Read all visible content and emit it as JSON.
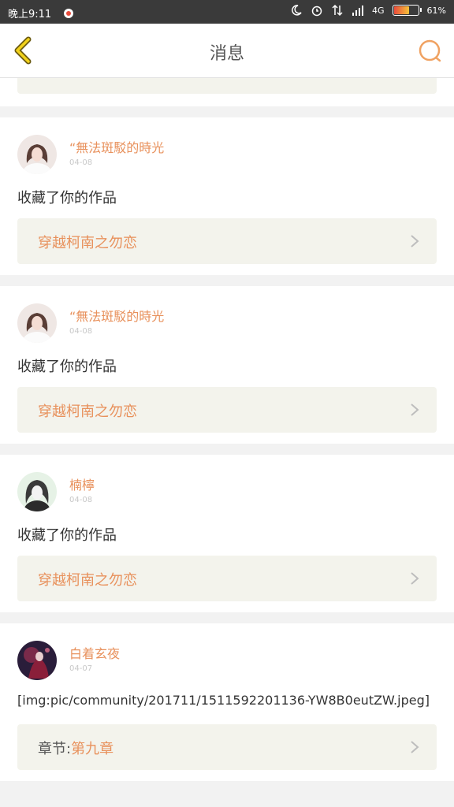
{
  "status_bar": {
    "time": "晚上9:11",
    "network": "4G",
    "battery": "61%",
    "battery_level": 0.61
  },
  "header": {
    "title": "消息",
    "back_icon": "chevron-left-icon",
    "search_icon": "search-icon"
  },
  "messages": [
    {
      "username": "“無法斑駁的時光",
      "date": "04-08",
      "content": "收藏了你的作品",
      "link_prefix": "",
      "link_text": "穿越柯南之勿恋"
    },
    {
      "username": "“無法斑駁的時光",
      "date": "04-08",
      "content": "收藏了你的作品",
      "link_prefix": "",
      "link_text": "穿越柯南之勿恋"
    },
    {
      "username": "楠檸",
      "date": "04-08",
      "content": "收藏了你的作品",
      "link_prefix": "",
      "link_text": "穿越柯南之勿恋"
    },
    {
      "username": "白着玄夜",
      "date": "04-07",
      "content": "[img:pic/community/201711/1511592201136-YW8B0eutZW.jpeg]",
      "link_prefix": "章节:",
      "link_text": "第九章"
    }
  ],
  "colors": {
    "accent": "#e8915c",
    "link_bg": "#f3f3ec",
    "status_bar": "#3a3a3a"
  }
}
